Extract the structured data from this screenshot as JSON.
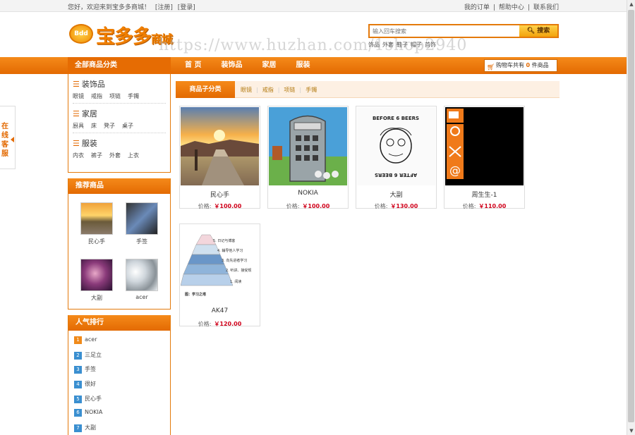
{
  "topbar": {
    "welcome": "您好，欢迎来到宝多多商城！",
    "register": "[注册]",
    "login": "[登录]",
    "my_orders": "我的订单",
    "help": "帮助中心",
    "contact": "联系我们"
  },
  "logo": {
    "badge": "Bdd",
    "main": "宝多多",
    "sub": "商城"
  },
  "watermark": "https://www.huzhan.com/1shop2940",
  "search": {
    "placeholder": "输入回车搜索",
    "button": "搜索",
    "hotwords": [
      "饰品",
      "外套",
      "鞋子",
      "帽子",
      "首饰"
    ]
  },
  "nav": {
    "all_categories": "全部商品分类",
    "items": [
      "首 页",
      "装饰品",
      "家居",
      "服装"
    ]
  },
  "cart": {
    "prefix": "购物车共有",
    "count": "0",
    "suffix": "件商品"
  },
  "categories": [
    {
      "title": "装饰品",
      "subs": [
        "眼镜",
        "戒指",
        "项链",
        "手镯"
      ]
    },
    {
      "title": "家居",
      "subs": [
        "厨具",
        "床",
        "凳子",
        "桌子"
      ]
    },
    {
      "title": "服装",
      "subs": [
        "内衣",
        "裤子",
        "外套",
        "上衣"
      ]
    }
  ],
  "recommend": {
    "title": "推荐商品",
    "items": [
      {
        "name": "民心手"
      },
      {
        "name": "手签"
      },
      {
        "name": "大副"
      },
      {
        "name": "acer"
      }
    ]
  },
  "popular": {
    "title": "人气排行",
    "items": [
      {
        "rank": "1",
        "name": "acer"
      },
      {
        "rank": "2",
        "name": "三足立"
      },
      {
        "rank": "3",
        "name": "手签"
      },
      {
        "rank": "4",
        "name": "很好"
      },
      {
        "rank": "5",
        "name": "民心手"
      },
      {
        "rank": "6",
        "name": "NOKIA"
      },
      {
        "rank": "7",
        "name": "大副"
      }
    ]
  },
  "subnav": {
    "tab": "商品子分类",
    "links": [
      "眼镜",
      "戒指",
      "项链",
      "手镯"
    ]
  },
  "price_label": "价格:",
  "products": [
    {
      "name": "民心手",
      "price": "￥100.00"
    },
    {
      "name": "NOKIA",
      "price": "￥100.00"
    },
    {
      "name": "大副",
      "price": "￥130.00"
    },
    {
      "name": "周生生-1",
      "price": "￥110.00"
    },
    {
      "name": "AK47",
      "price": "￥120.00"
    }
  ],
  "product_images": {
    "p3_top": "BEFORE 6 BEERS",
    "p3_bottom": "AFTER 6 BEERS",
    "p5_caption": "图：学习之塔",
    "p5_levels": [
      "5. 日记与博客",
      "4. 辅导他人学习",
      "3. 向先进者学习",
      "2. 听讲、接受规",
      "1. 阅读"
    ]
  },
  "kefu": {
    "text": "在线客服"
  },
  "colors": {
    "brand_orange": "#e36a02",
    "price_red": "#d0021b",
    "rank_blue": "#3a8fd0"
  }
}
